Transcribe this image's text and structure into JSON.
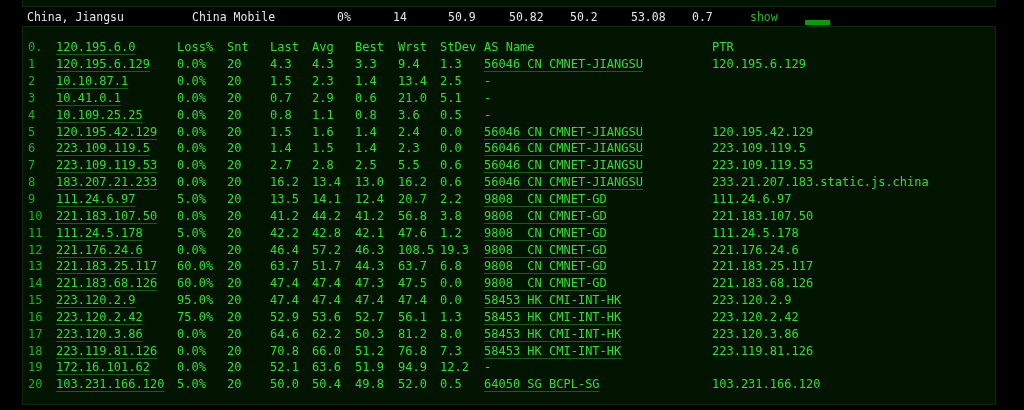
{
  "summary": {
    "location": "China, Jiangsu",
    "isp": "China Mobile",
    "loss": "0%",
    "hops": "14",
    "last": "50.9",
    "avg": "50.82",
    "best": "50.2",
    "worst": "53.08",
    "stdev": "0.7",
    "link": "show"
  },
  "trace": {
    "header": {
      "hop": "0.",
      "host": "120.195.6.0",
      "columns": [
        "Loss%",
        "Snt",
        "Last",
        "Avg",
        "Best",
        "Wrst",
        "StDev",
        "AS Name",
        "PTR"
      ]
    },
    "rows": [
      {
        "hop": "1",
        "host": "120.195.6.129",
        "loss": "0.0%",
        "snt": "20",
        "last": "4.3",
        "avg": "4.3",
        "best": "3.3",
        "wrst": "9.4",
        "stdev": "1.3",
        "as_name": "56046 CN CMNET-JIANGSU",
        "as_link": true,
        "ptr": "120.195.6.129"
      },
      {
        "hop": "2",
        "host": "10.10.87.1",
        "loss": "0.0%",
        "snt": "20",
        "last": "1.5",
        "avg": "2.3",
        "best": "1.4",
        "wrst": "13.4",
        "stdev": "2.5",
        "as_name": "-",
        "as_link": false
      },
      {
        "hop": "3",
        "host": "10.41.0.1",
        "loss": "0.0%",
        "snt": "20",
        "last": "0.7",
        "avg": "2.9",
        "best": "0.6",
        "wrst": "21.0",
        "stdev": "5.1",
        "as_name": "-",
        "as_link": false
      },
      {
        "hop": "4",
        "host": "10.109.25.25",
        "loss": "0.0%",
        "snt": "20",
        "last": "0.8",
        "avg": "1.1",
        "best": "0.8",
        "wrst": "3.6",
        "stdev": "0.5",
        "as_name": "-",
        "as_link": false
      },
      {
        "hop": "5",
        "host": "120.195.42.129",
        "loss": "0.0%",
        "snt": "20",
        "last": "1.5",
        "avg": "1.6",
        "best": "1.4",
        "wrst": "2.4",
        "stdev": "0.0",
        "as_name": "56046 CN CMNET-JIANGSU",
        "as_link": true,
        "ptr": "120.195.42.129"
      },
      {
        "hop": "6",
        "host": "223.109.119.5",
        "loss": "0.0%",
        "snt": "20",
        "last": "1.4",
        "avg": "1.5",
        "best": "1.4",
        "wrst": "2.3",
        "stdev": "0.0",
        "as_name": "56046 CN CMNET-JIANGSU",
        "as_link": true,
        "ptr": "223.109.119.5"
      },
      {
        "hop": "7",
        "host": "223.109.119.53",
        "loss": "0.0%",
        "snt": "20",
        "last": "2.7",
        "avg": "2.8",
        "best": "2.5",
        "wrst": "5.5",
        "stdev": "0.6",
        "as_name": "56046 CN CMNET-JIANGSU",
        "as_link": true,
        "ptr": "223.109.119.53"
      },
      {
        "hop": "8",
        "host": "183.207.21.233",
        "loss": "0.0%",
        "snt": "20",
        "last": "16.2",
        "avg": "13.4",
        "best": "13.0",
        "wrst": "16.2",
        "stdev": "0.6",
        "as_name": "56046 CN CMNET-JIANGSU",
        "as_link": true,
        "ptr": "233.21.207.183.static.js.china"
      },
      {
        "hop": "9",
        "host": "111.24.6.97",
        "loss": "5.0%",
        "snt": "20",
        "last": "13.5",
        "avg": "14.1",
        "best": "12.4",
        "wrst": "20.7",
        "stdev": "2.2",
        "as_name": "9808  CN CMNET-GD",
        "as_link": true,
        "ptr": "111.24.6.97"
      },
      {
        "hop": "10",
        "host": "221.183.107.50",
        "loss": "0.0%",
        "snt": "20",
        "last": "41.2",
        "avg": "44.2",
        "best": "41.2",
        "wrst": "56.8",
        "stdev": "3.8",
        "as_name": "9808  CN CMNET-GD",
        "as_link": true,
        "ptr": "221.183.107.50"
      },
      {
        "hop": "11",
        "host": "111.24.5.178",
        "loss": "5.0%",
        "snt": "20",
        "last": "42.2",
        "avg": "42.8",
        "best": "42.1",
        "wrst": "47.6",
        "stdev": "1.2",
        "as_name": "9808  CN CMNET-GD",
        "as_link": true,
        "ptr": "111.24.5.178"
      },
      {
        "hop": "12",
        "host": "221.176.24.6",
        "loss": "0.0%",
        "snt": "20",
        "last": "46.4",
        "avg": "57.2",
        "best": "46.3",
        "wrst": "108.5",
        "stdev": "19.3",
        "as_name": "9808  CN CMNET-GD",
        "as_link": true,
        "ptr": "221.176.24.6"
      },
      {
        "hop": "13",
        "host": "221.183.25.117",
        "loss": "60.0%",
        "snt": "20",
        "last": "63.7",
        "avg": "51.7",
        "best": "44.3",
        "wrst": "63.7",
        "stdev": "6.8",
        "as_name": "9808  CN CMNET-GD",
        "as_link": true,
        "ptr": "221.183.25.117"
      },
      {
        "hop": "14",
        "host": "221.183.68.126",
        "loss": "60.0%",
        "snt": "20",
        "last": "47.4",
        "avg": "47.4",
        "best": "47.3",
        "wrst": "47.5",
        "stdev": "0.0",
        "as_name": "9808  CN CMNET-GD",
        "as_link": true,
        "ptr": "221.183.68.126"
      },
      {
        "hop": "15",
        "host": "223.120.2.9",
        "loss": "95.0%",
        "snt": "20",
        "last": "47.4",
        "avg": "47.4",
        "best": "47.4",
        "wrst": "47.4",
        "stdev": "0.0",
        "as_name": "58453 HK CMI-INT-HK",
        "as_link": true,
        "ptr": "223.120.2.9"
      },
      {
        "hop": "16",
        "host": "223.120.2.42",
        "loss": "75.0%",
        "snt": "20",
        "last": "52.9",
        "avg": "53.6",
        "best": "52.7",
        "wrst": "56.1",
        "stdev": "1.3",
        "as_name": "58453 HK CMI-INT-HK",
        "as_link": true,
        "ptr": "223.120.2.42"
      },
      {
        "hop": "17",
        "host": "223.120.3.86",
        "loss": "0.0%",
        "snt": "20",
        "last": "64.6",
        "avg": "62.2",
        "best": "50.3",
        "wrst": "81.2",
        "stdev": "8.0",
        "as_name": "58453 HK CMI-INT-HK",
        "as_link": true,
        "ptr": "223.120.3.86"
      },
      {
        "hop": "18",
        "host": "223.119.81.126",
        "loss": "0.0%",
        "snt": "20",
        "last": "70.8",
        "avg": "66.0",
        "best": "51.2",
        "wrst": "76.8",
        "stdev": "7.3",
        "as_name": "58453 HK CMI-INT-HK",
        "as_link": true,
        "ptr": "223.119.81.126"
      },
      {
        "hop": "19",
        "host": "172.16.101.62",
        "loss": "0.0%",
        "snt": "20",
        "last": "52.1",
        "avg": "63.6",
        "best": "51.9",
        "wrst": "94.9",
        "stdev": "12.2",
        "as_name": "-",
        "as_link": false
      },
      {
        "hop": "20",
        "host": "103.231.166.120",
        "loss": "5.0%",
        "snt": "20",
        "last": "50.0",
        "avg": "50.4",
        "best": "49.8",
        "wrst": "52.0",
        "stdev": "0.5",
        "as_name": "64050 SG BCPL-SG",
        "as_link": true,
        "ptr": "103.231.166.120"
      }
    ]
  }
}
